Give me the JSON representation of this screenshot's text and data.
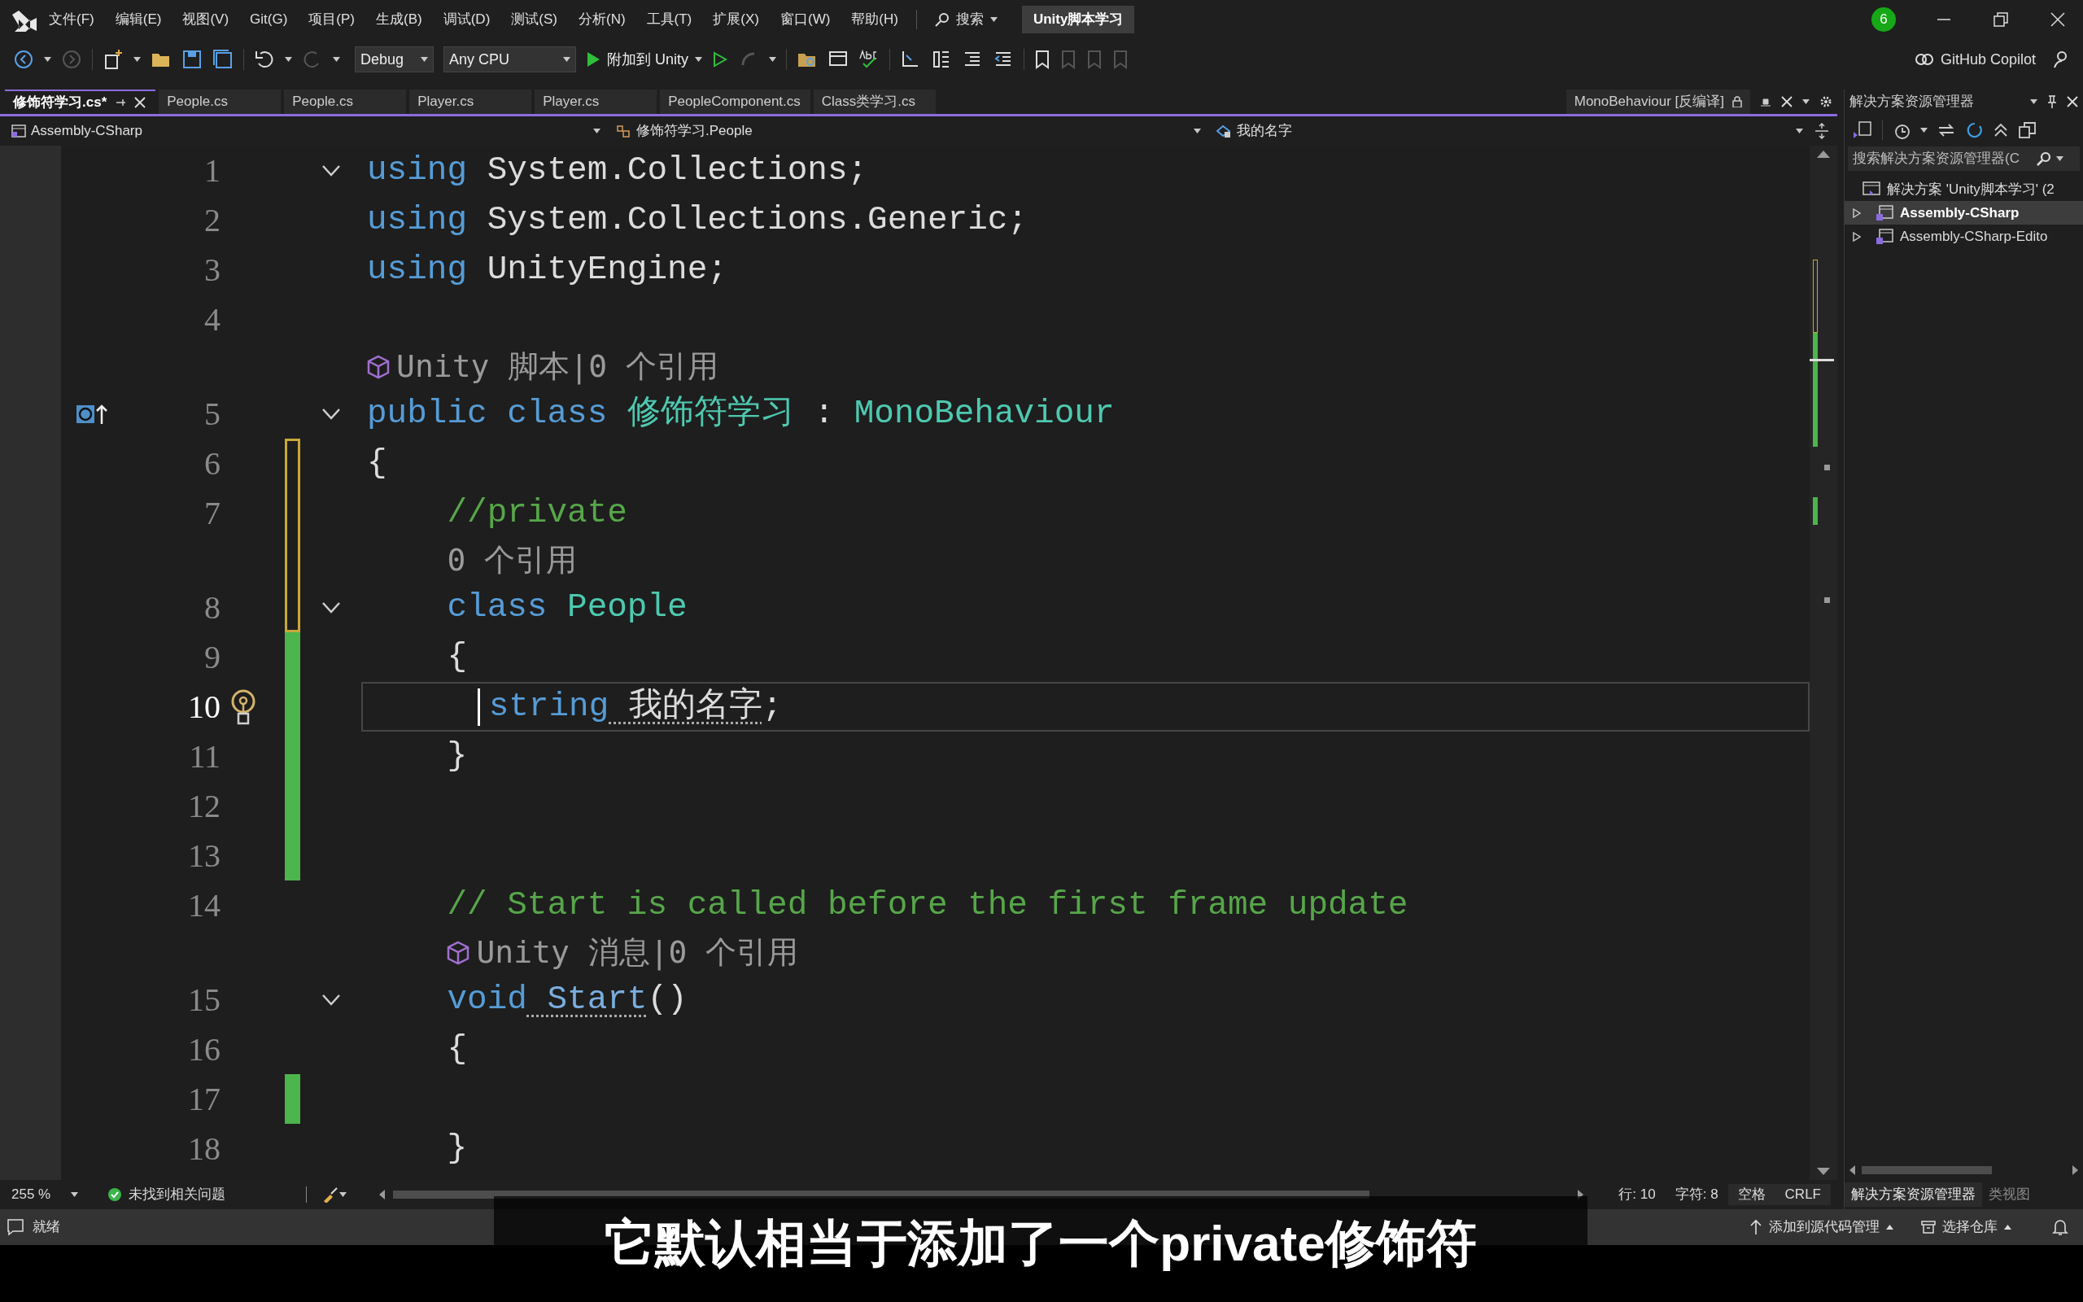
{
  "title_bar": {
    "menus": [
      "文件(F)",
      "编辑(E)",
      "视图(V)",
      "Git(G)",
      "项目(P)",
      "生成(B)",
      "调试(D)",
      "测试(S)",
      "分析(N)",
      "工具(T)",
      "扩展(X)",
      "窗口(W)",
      "帮助(H)"
    ],
    "search": "搜索",
    "solution_name": "Unity脚本学习",
    "notification_count": "6"
  },
  "toolbar": {
    "configuration": "Debug",
    "platform": "Any CPU",
    "run_target": "附加到 Unity",
    "copilot": "GitHub Copilot"
  },
  "tabs": [
    {
      "label": "修饰符学习.cs*",
      "selected": true
    },
    {
      "label": "People.cs",
      "selected": false
    },
    {
      "label": "People.cs",
      "selected": false
    },
    {
      "label": "Player.cs",
      "selected": false
    },
    {
      "label": "Player.cs",
      "selected": false
    },
    {
      "label": "PeopleComponent.cs",
      "selected": false
    },
    {
      "label": "Class类学习.cs",
      "selected": false
    }
  ],
  "preview_tab": {
    "label": "MonoBehaviour [反编译]"
  },
  "nav_bar": {
    "project": "Assembly-CSharp",
    "type": "修饰符学习.People",
    "member": "我的名字"
  },
  "code_rows": [
    {
      "kind": "code",
      "number": "1",
      "fold": true,
      "modified": false,
      "saved": false,
      "current": false,
      "inheritance_glyph": false,
      "lightbulb": false,
      "indent": "",
      "tokens": [
        {
          "text": "using",
          "kind": "keyword"
        },
        {
          "text": " System.Collections;",
          "kind": "plain"
        }
      ]
    },
    {
      "kind": "code",
      "number": "2",
      "fold": false,
      "modified": false,
      "saved": false,
      "current": false,
      "inheritance_glyph": false,
      "lightbulb": false,
      "indent": "",
      "tokens": [
        {
          "text": "using",
          "kind": "keyword"
        },
        {
          "text": " System.Collections.Generic;",
          "kind": "plain"
        }
      ]
    },
    {
      "kind": "code",
      "number": "3",
      "fold": false,
      "modified": false,
      "saved": false,
      "current": false,
      "inheritance_glyph": false,
      "lightbulb": false,
      "indent": "",
      "tokens": [
        {
          "text": "using",
          "kind": "keyword"
        },
        {
          "text": " UnityEngine;",
          "kind": "plain"
        }
      ]
    },
    {
      "kind": "code",
      "number": "4",
      "fold": false,
      "modified": false,
      "saved": false,
      "current": false,
      "inheritance_glyph": false,
      "lightbulb": false,
      "indent": "",
      "tokens": []
    },
    {
      "kind": "lens",
      "text": "Unity 脚本|0 个引用",
      "unity_icon": true,
      "modified": false,
      "saved": false,
      "indent": ""
    },
    {
      "kind": "code",
      "number": "5",
      "fold": true,
      "modified": false,
      "saved": false,
      "current": false,
      "inheritance_glyph": true,
      "lightbulb": false,
      "indent": "",
      "tokens": [
        {
          "text": "public class",
          "kind": "keyword"
        },
        {
          "text": " 修饰符学习",
          "kind": "type"
        },
        {
          "text": " :",
          "kind": "plain"
        },
        {
          "text": " MonoBehaviour",
          "kind": "type"
        }
      ]
    },
    {
      "kind": "code",
      "number": "6",
      "fold": false,
      "modified": true,
      "saved": false,
      "current": false,
      "inheritance_glyph": false,
      "lightbulb": false,
      "indent": "",
      "tokens": [
        {
          "text": "{",
          "kind": "plain"
        }
      ]
    },
    {
      "kind": "code",
      "number": "7",
      "fold": false,
      "modified": true,
      "saved": false,
      "current": false,
      "inheritance_glyph": false,
      "lightbulb": false,
      "indent": "    ",
      "tokens": [
        {
          "text": "//private",
          "kind": "comment"
        }
      ]
    },
    {
      "kind": "lens",
      "text": "0 个引用",
      "unity_icon": false,
      "modified": true,
      "saved": false,
      "indent": "    "
    },
    {
      "kind": "code",
      "number": "8",
      "fold": true,
      "modified": true,
      "saved": false,
      "current": false,
      "inheritance_glyph": false,
      "lightbulb": false,
      "indent": "    ",
      "tokens": [
        {
          "text": "class",
          "kind": "keyword"
        },
        {
          "text": " People",
          "kind": "type"
        }
      ]
    },
    {
      "kind": "code",
      "number": "9",
      "fold": false,
      "modified": false,
      "saved": true,
      "current": false,
      "inheritance_glyph": false,
      "lightbulb": false,
      "indent": "    ",
      "tokens": [
        {
          "text": "{",
          "kind": "plain"
        }
      ]
    },
    {
      "kind": "code",
      "number": "10",
      "fold": false,
      "modified": false,
      "saved": true,
      "current": true,
      "inheritance_glyph": false,
      "lightbulb": true,
      "indent": "      ",
      "tokens": [
        {
          "text": "string",
          "kind": "keyword"
        },
        {
          "text": " 我的名字",
          "kind": "plain",
          "dotted": true
        },
        {
          "text": ";",
          "kind": "plain"
        }
      ]
    },
    {
      "kind": "code",
      "number": "11",
      "fold": false,
      "modified": false,
      "saved": true,
      "current": false,
      "inheritance_glyph": false,
      "lightbulb": false,
      "indent": "    ",
      "tokens": [
        {
          "text": "}",
          "kind": "plain"
        }
      ]
    },
    {
      "kind": "code",
      "number": "12",
      "fold": false,
      "modified": false,
      "saved": true,
      "current": false,
      "inheritance_glyph": false,
      "lightbulb": false,
      "indent": "",
      "tokens": []
    },
    {
      "kind": "code",
      "number": "13",
      "fold": false,
      "modified": false,
      "saved": true,
      "current": false,
      "inheritance_glyph": false,
      "lightbulb": false,
      "indent": "",
      "tokens": []
    },
    {
      "kind": "code",
      "number": "14",
      "fold": false,
      "modified": false,
      "saved": false,
      "current": false,
      "inheritance_glyph": false,
      "lightbulb": false,
      "indent": "    ",
      "tokens": [
        {
          "text": "// Start is called before the first frame update",
          "kind": "comment"
        }
      ]
    },
    {
      "kind": "lens",
      "text": "Unity 消息|0 个引用",
      "unity_icon": true,
      "modified": false,
      "saved": false,
      "indent": "    "
    },
    {
      "kind": "code",
      "number": "15",
      "fold": true,
      "modified": false,
      "saved": false,
      "current": false,
      "inheritance_glyph": false,
      "lightbulb": false,
      "indent": "    ",
      "tokens": [
        {
          "text": "void",
          "kind": "keyword"
        },
        {
          "text": " Start",
          "kind": "method",
          "dotted": true
        },
        {
          "text": "()",
          "kind": "plain"
        }
      ]
    },
    {
      "kind": "code",
      "number": "16",
      "fold": false,
      "modified": false,
      "saved": false,
      "current": false,
      "inheritance_glyph": false,
      "lightbulb": false,
      "indent": "    ",
      "tokens": [
        {
          "text": "{",
          "kind": "plain"
        }
      ]
    },
    {
      "kind": "code",
      "number": "17",
      "fold": false,
      "modified": false,
      "saved": true,
      "current": false,
      "inheritance_glyph": false,
      "lightbulb": false,
      "indent": "",
      "tokens": []
    },
    {
      "kind": "code",
      "number": "18",
      "fold": false,
      "modified": false,
      "saved": false,
      "current": false,
      "inheritance_glyph": false,
      "lightbulb": false,
      "indent": "    ",
      "tokens": [
        {
          "text": "}",
          "kind": "plain"
        }
      ]
    }
  ],
  "editor_status": {
    "zoom": "255 %",
    "issues": "未找到相关问题",
    "line": "行: 10",
    "column": "字符: 8",
    "indent_mode": "空格",
    "line_endings": "CRLF"
  },
  "solution_explorer": {
    "title": "解决方案资源管理器",
    "search_placeholder": "搜索解决方案资源管理器(C",
    "tree": [
      {
        "label": "解决方案 'Unity脚本学习' (2",
        "selected": false,
        "children": [
          {
            "label": "Assembly-CSharp",
            "selected": true,
            "expanded": false
          },
          {
            "label": "Assembly-CSharp-Edito",
            "selected": false,
            "expanded": false
          }
        ]
      }
    ],
    "bottom_tabs": [
      {
        "label": "解决方案资源管理器",
        "selected": true
      },
      {
        "label": "类视图",
        "selected": false
      }
    ]
  },
  "status_bar": {
    "state": "就绪",
    "source_control": "添加到源代码管理",
    "repository": "选择仓库"
  },
  "subtitle": "它默认相当于添加了一个private修饰符"
}
